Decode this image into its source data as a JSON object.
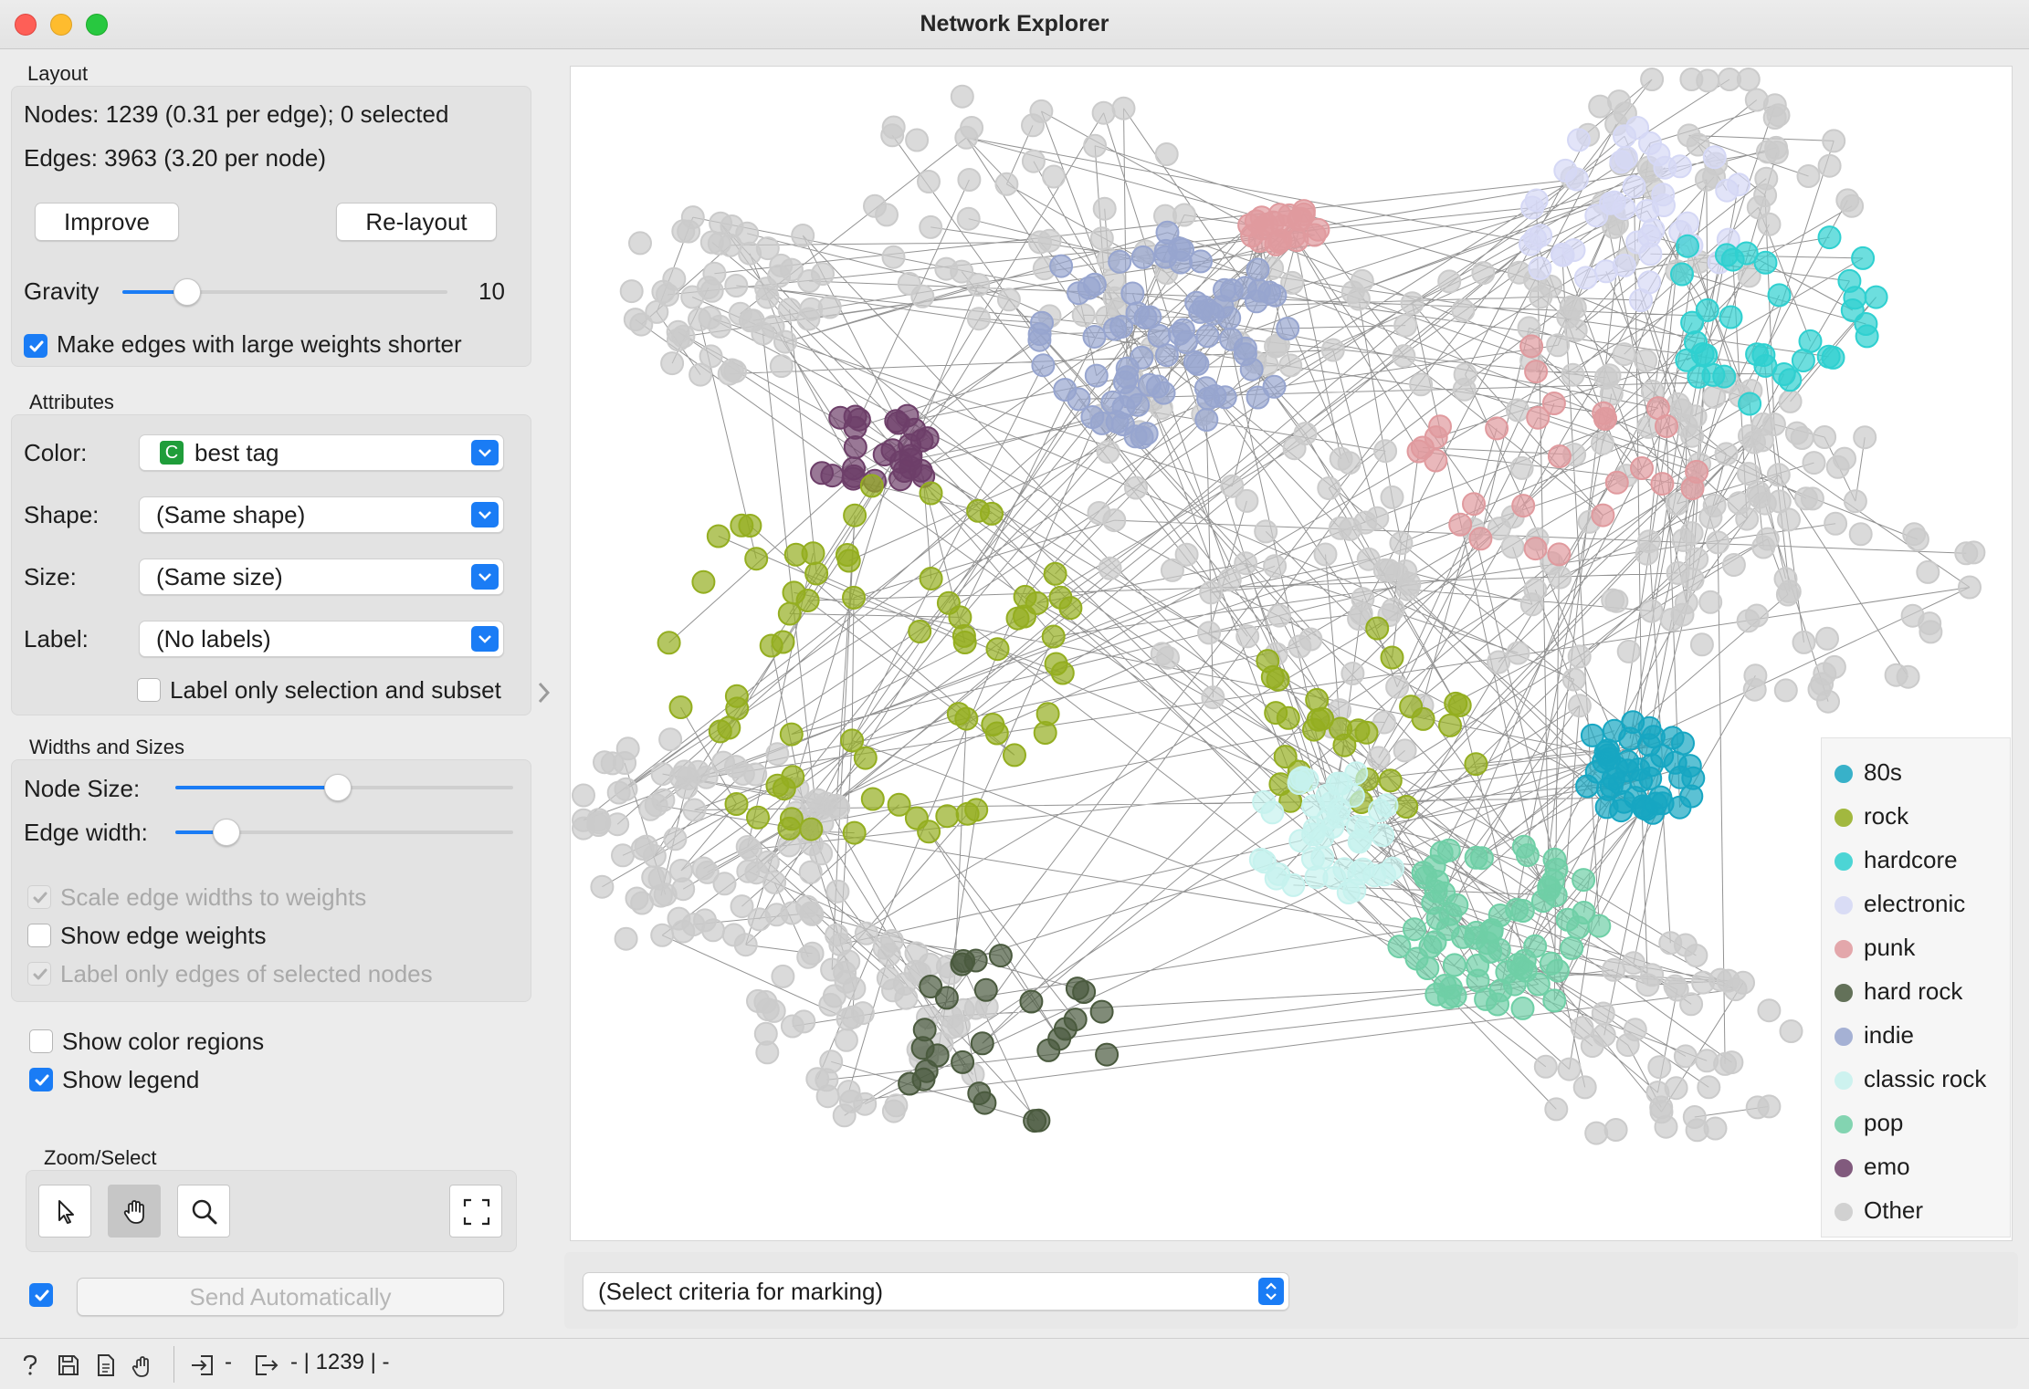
{
  "window": {
    "title": "Network Explorer"
  },
  "layout": {
    "section": "Layout",
    "nodes_info": "Nodes: 1239 (0.31 per edge); 0 selected",
    "edges_info": "Edges: 3963 (3.20 per node)",
    "improve_label": "Improve",
    "relayout_label": "Re-layout",
    "gravity_label": "Gravity",
    "gravity_value": "10",
    "gravity_level": 0.2,
    "shorter_edges_label": "Make edges with large weights shorter",
    "shorter_edges_checked": true
  },
  "attributes": {
    "section": "Attributes",
    "color_label": "Color:",
    "color_badge": "C",
    "color_value": "best tag",
    "shape_label": "Shape:",
    "shape_value": "(Same shape)",
    "size_label": "Size:",
    "size_value": "(Same size)",
    "label_label": "Label:",
    "label_value": "(No labels)",
    "label_only_selection": "Label only selection and subset"
  },
  "widths": {
    "section": "Widths and Sizes",
    "node_size_label": "Node Size:",
    "node_size_level": 0.48,
    "edge_width_label": "Edge width:",
    "edge_width_level": 0.15,
    "scale_edges": "Scale edge widths to weights",
    "show_edge_weights": "Show edge weights",
    "label_only_selected": "Label only edges of selected nodes"
  },
  "display": {
    "show_color_regions": "Show color regions",
    "show_legend": "Show legend",
    "show_legend_checked": true
  },
  "zoom": {
    "section": "Zoom/Select"
  },
  "send": {
    "label": "Send Automatically",
    "checked": true
  },
  "marking": {
    "value": "(Select criteria for marking)"
  },
  "legend": [
    {
      "label": "80s",
      "color": "#17a6c2"
    },
    {
      "label": "rock",
      "color": "#94ae20"
    },
    {
      "label": "hardcore",
      "color": "#2fd0d0"
    },
    {
      "label": "electronic",
      "color": "#d5d8f5"
    },
    {
      "label": "punk",
      "color": "#e09a9e"
    },
    {
      "label": "hard rock",
      "color": "#4a5a3e"
    },
    {
      "label": "indie",
      "color": "#97a5cf"
    },
    {
      "label": "classic rock",
      "color": "#c6f2ee"
    },
    {
      "label": "pop",
      "color": "#6fcfa6"
    },
    {
      "label": "emo",
      "color": "#6d3f69"
    },
    {
      "label": "Other",
      "color": "#cbcbcb"
    }
  ],
  "status_bar": {
    "inputs": "-",
    "outputs": "- | 1239 | -"
  }
}
